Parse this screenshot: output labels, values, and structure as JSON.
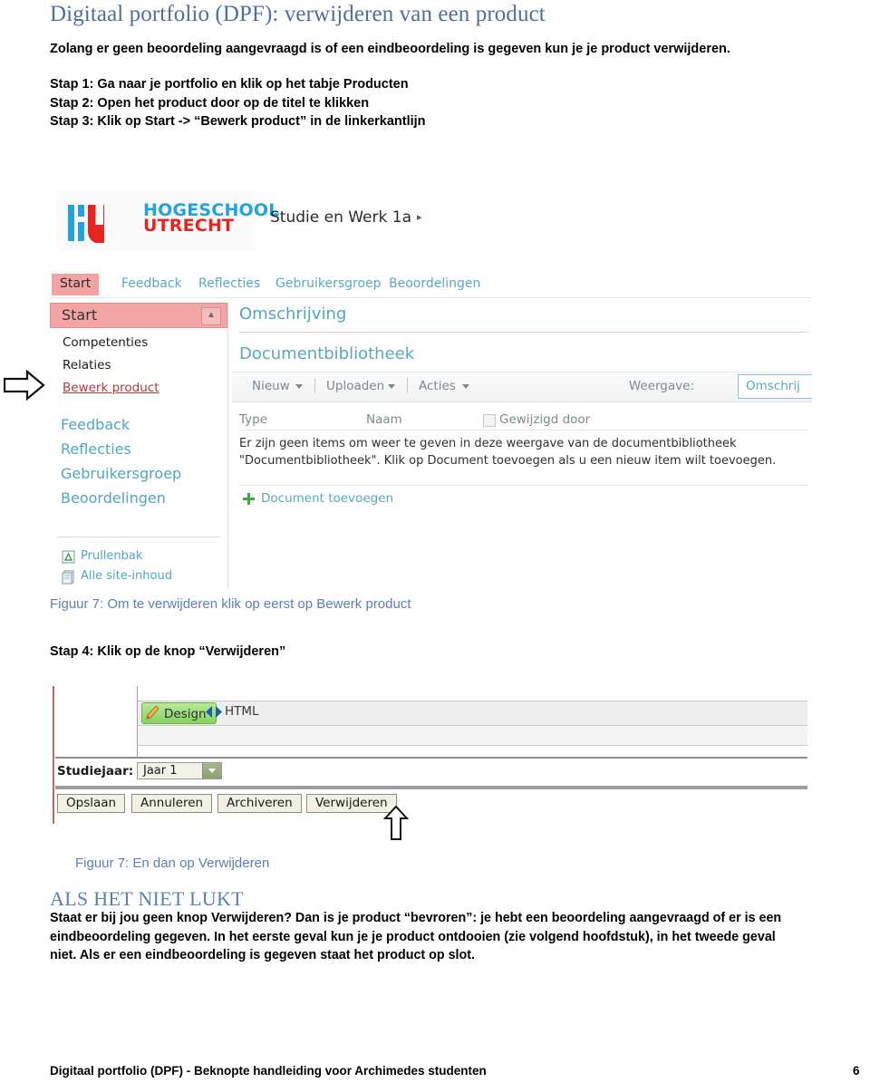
{
  "document": {
    "title": "Digitaal portfolio (DPF): verwijderen van een product",
    "intro": "Zolang er geen beoordeling aangevraagd is of een eindbeoordeling is gegeven kun je je product verwijderen.",
    "steps": [
      "Stap 1: Ga naar je portfolio en klik op het tabje Producten",
      "Stap 2: Open het product door op de titel te klikken",
      "Stap 3: Klik op Start -> “Bewerk product” in de linkerkantlijn"
    ],
    "caption1": "Figuur 7: Om te verwijderen klik op eerst op Bewerk product",
    "stap4": "Stap 4: Klik op de knop “Verwijderen”",
    "caption2": "Figuur 7: En dan op Verwijderen",
    "section_heading": "ALS HET NIET LUKT",
    "body": "Staat er bij jou geen knop Verwijderen? Dan is je product “bevroren”:  je hebt een beoordeling aangevraagd of er is een eindbeoordeling gegeven. In het eerste geval kun je je product ontdooien (zie volgend hoofdstuk), in het tweede geval niet. Als er een eindbeoordeling is gegeven staat het product op slot.",
    "footer": "Digitaal portfolio (DPF) - Beknopte handleiding voor Archimedes studenten",
    "page_number": "6"
  },
  "colors": {
    "heading_blue": "#5b7fb3",
    "logo_blue": "#23a3dd",
    "logo_red": "#e8241f",
    "tab_active_pink": "#f3a3a3",
    "link_teal": "#5aa8c0",
    "design_green": "#86d25f"
  },
  "screenshot1": {
    "logo": {
      "line1": "HOGESCHOOL",
      "line2": "UTRECHT"
    },
    "site_name": "Studie en Werk 1a",
    "site_caret": "▸",
    "tabs": [
      {
        "label": "Start",
        "active": true
      },
      {
        "label": "Feedback",
        "active": false
      },
      {
        "label": "Reflecties",
        "active": false
      },
      {
        "label": "Gebruikersgroep",
        "active": false
      },
      {
        "label": "Beoordelingen",
        "active": false
      }
    ],
    "leftnav": {
      "header": "Start",
      "sub_items": [
        "Competenties",
        "Relaties",
        "Bewerk product"
      ],
      "main_items": [
        "Feedback",
        "Reflecties",
        "Gebruikersgroep",
        "Beoordelingen"
      ],
      "foot_items": [
        "Prullenbak",
        "Alle site-inhoud"
      ]
    },
    "content": {
      "heading_omschrijving": "Omschrijving",
      "heading_doclib": "Documentbibliotheek",
      "toolbar": {
        "nieuw": "Nieuw",
        "uploaden": "Uploaden",
        "acties": "Acties",
        "weergave_label": "Weergave:",
        "weergave_value": "Omschrij"
      },
      "columns": [
        "Type",
        "Naam",
        "Gewijzigd door"
      ],
      "empty_message": "Er zijn geen items om weer te geven in deze weergave van de documentbibliotheek \"Documentbibliotheek\". Klik op Document toevoegen als u een nieuw item wilt toevoegen.",
      "add_document": "Document toevoegen"
    }
  },
  "screenshot2": {
    "design_tab": "Design",
    "html_tab": "HTML",
    "studiejaar_label": "Studiejaar:",
    "studiejaar_value": "Jaar 1",
    "buttons": [
      "Opslaan",
      "Annuleren",
      "Archiveren",
      "Verwijderen"
    ]
  }
}
